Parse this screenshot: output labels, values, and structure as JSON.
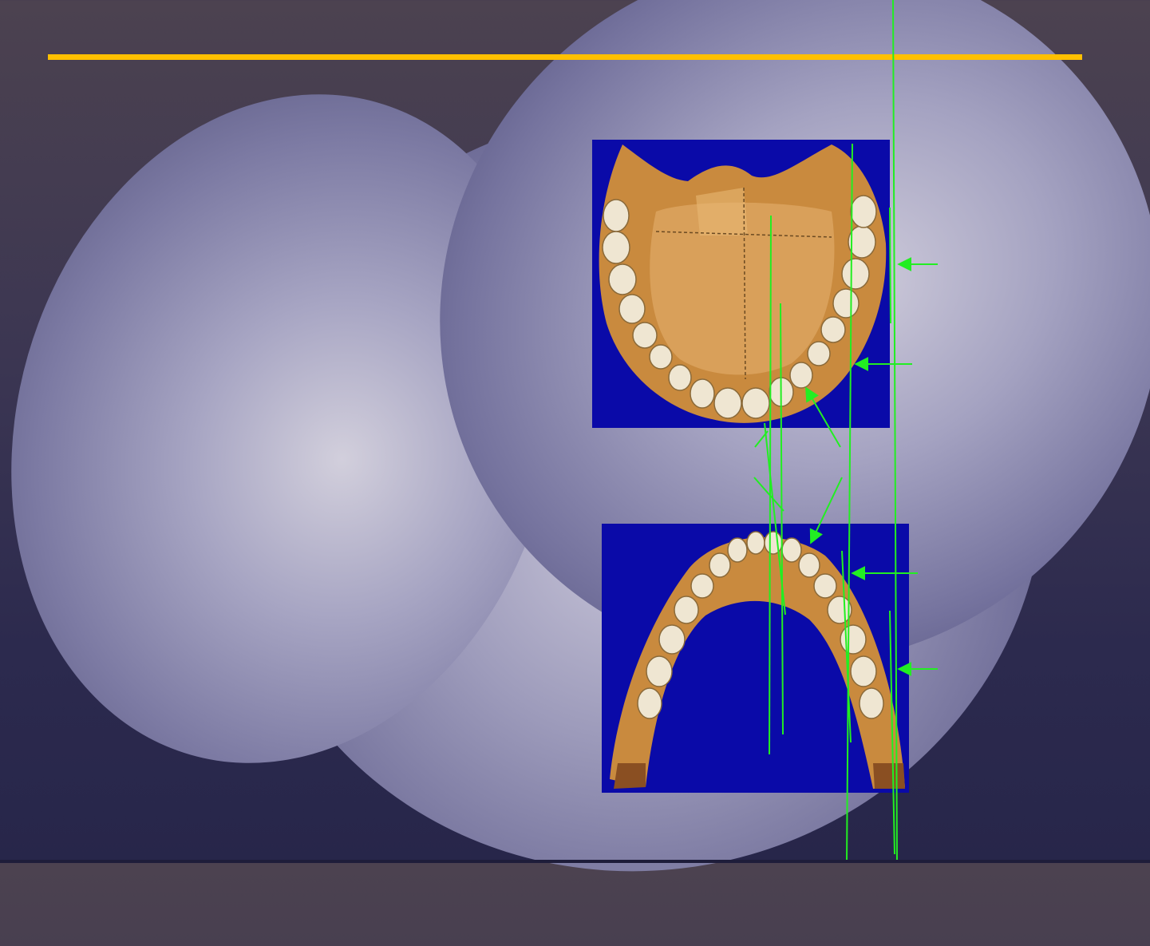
{
  "slide": {
    "title": "",
    "background": "#3a3552",
    "accent_rule_color": "#ffc000",
    "annotation_color": "#22ee22"
  },
  "images": {
    "upper": {
      "subject": "maxilla-dental-arch-photo",
      "background": "#0a0aa8",
      "bone": "#c98a3e",
      "tooth": "#efe6d2"
    },
    "lower": {
      "subject": "mandible-dental-arch-photo",
      "background": "#0a0aa8",
      "bone": "#c98a3e",
      "tooth": "#efe6d2"
    }
  },
  "icons": [
    "arrow-left-icon",
    "leader-line"
  ]
}
